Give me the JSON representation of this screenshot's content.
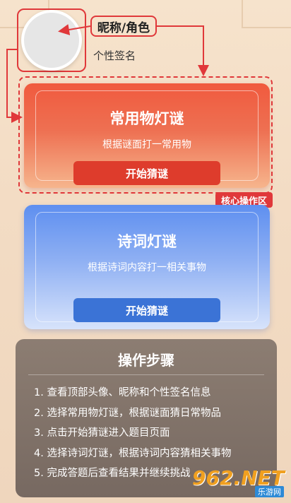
{
  "profile": {
    "nickname_label": "昵称/角色",
    "signature_label": "个性签名"
  },
  "core_zone": {
    "tag": "核心操作区"
  },
  "cards": [
    {
      "title": "常用物灯谜",
      "subtitle": "根据谜面打一常用物",
      "button": "开始猜谜",
      "color": "#ee5a3e"
    },
    {
      "title": "诗词灯谜",
      "subtitle": "根据诗词内容打一相关事物",
      "button": "开始猜谜",
      "color": "#5e8ff0"
    }
  ],
  "steps": {
    "title": "操作步骤",
    "items": [
      "1. 查看顶部头像、昵称和个性签名信息",
      "2. 选择常用物灯谜，根据谜面猜日常物品",
      "3. 点击开始猜谜进入题目页面",
      "4. 选择诗词灯谜，根据诗词内容猜相关事物",
      "5. 完成答题后查看结果并继续挑战"
    ]
  },
  "watermark": {
    "text": "962.NET",
    "sub": "乐游网"
  },
  "colors": {
    "annotation": "#e0383a",
    "background": "#f3dcc4",
    "steps_panel": "#827369"
  }
}
